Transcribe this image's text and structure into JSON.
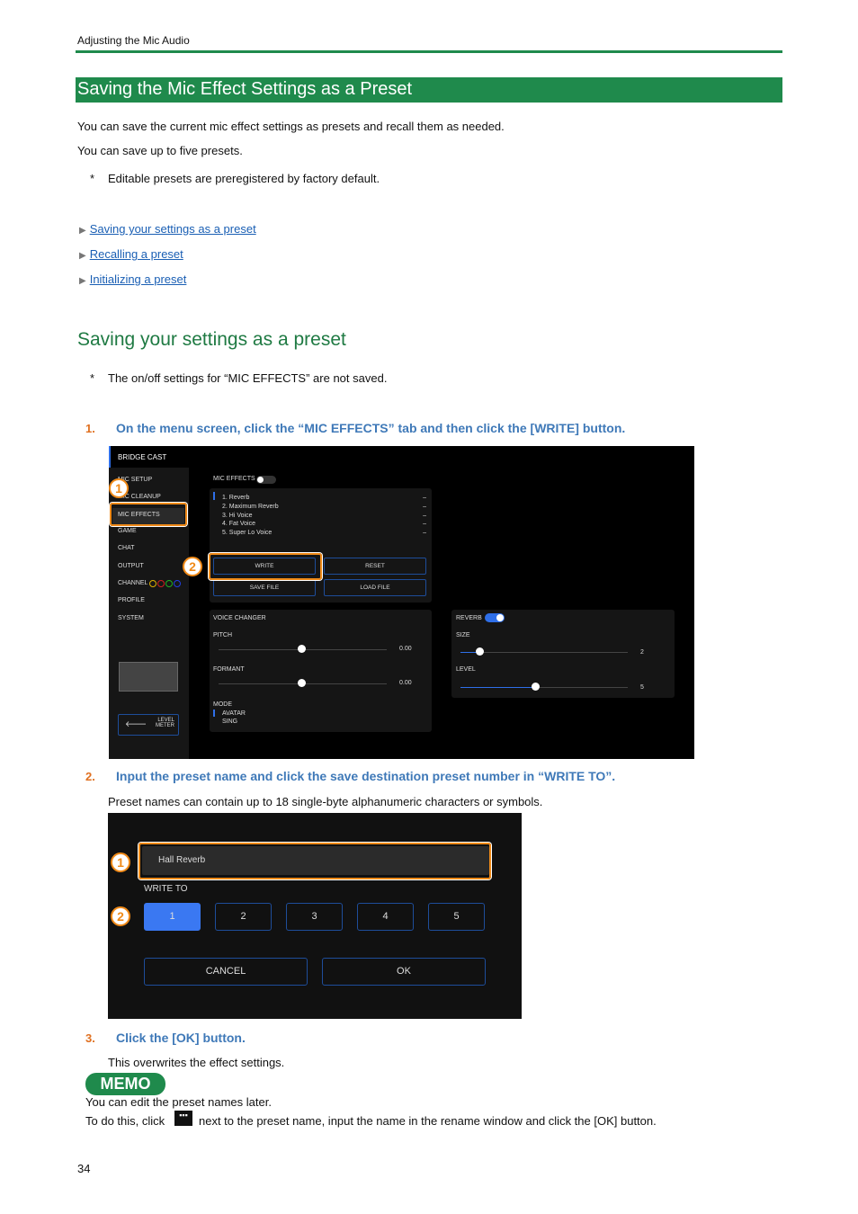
{
  "header": {
    "section": "Adjusting the Mic Audio"
  },
  "title": "Saving the Mic Effect Settings as a Preset",
  "intro": [
    "You can save the current mic effect settings as presets and recall them as needed.",
    "You can save up to five presets."
  ],
  "note1": "Editable presets are preregistered by factory default.",
  "bullet": "*",
  "links": [
    "Saving your settings as a preset",
    "Recalling a preset",
    "Initializing a preset"
  ],
  "subtitle": "Saving your settings as a preset",
  "note2": "The on/off settings for “MIC EFFECTS” are not saved.",
  "steps": [
    {
      "num": "1.",
      "text": "On the menu screen, click the “MIC EFFECTS” tab and then click the [WRITE] button."
    },
    {
      "num": "2.",
      "text": "Input the preset name and click the save destination preset number in “WRITE TO”.",
      "desc": "Preset names can contain up to 18 single-byte alphanumeric characters or symbols."
    },
    {
      "num": "3.",
      "text": "Click the [OK] button.",
      "desc": "This overwrites the effect settings."
    }
  ],
  "app": {
    "title": "BRIDGE CAST",
    "menu": [
      "MIC SETUP",
      "MIC CLEANUP",
      "MIC EFFECTS",
      "GAME",
      "CHAT",
      "OUTPUT",
      "CHANNEL",
      "PROFILE",
      "SYSTEM"
    ],
    "channel_colors": [
      "#e0b000",
      "#d02020",
      "#20b020",
      "#2040e0"
    ],
    "mic_effects_label": "MIC EFFECTS",
    "presets": [
      "1. Reverb",
      "2. Maximum Reverb",
      "3. Hi Voice",
      "4. Fat Voice",
      "5. Super Lo Voice"
    ],
    "preset_dash": "–",
    "buttons": {
      "write": "WRITE",
      "reset": "RESET",
      "save_file": "SAVE FILE",
      "load_file": "LOAD FILE"
    },
    "level_meter": [
      "LEVEL",
      "METER"
    ],
    "voice_changer": {
      "title": "VOICE CHANGER",
      "pitch_label": "PITCH",
      "pitch_value": "0.00",
      "formant_label": "FORMANT",
      "formant_value": "0.00",
      "mode_label": "MODE",
      "modes": [
        "AVATAR",
        "SING"
      ]
    },
    "reverb": {
      "title": "REVERB",
      "size_label": "SIZE",
      "size_value": "2",
      "level_label": "LEVEL",
      "level_value": "5"
    },
    "accent": "#2f6fe8"
  },
  "dialog": {
    "name_value": "Hall Reverb",
    "write_to_label": "WRITE TO",
    "slots": [
      "1",
      "2",
      "3",
      "4",
      "5"
    ],
    "selected_slot": "1",
    "cancel": "CANCEL",
    "ok": "OK"
  },
  "callouts": [
    "1",
    "2"
  ],
  "memo": {
    "label": "MEMO",
    "line1": "You can edit the preset names later.",
    "line2a": "To do this, click",
    "line2b": "next to the preset name, input the name in the rename window and click the [OK] button."
  },
  "page_number": "34"
}
